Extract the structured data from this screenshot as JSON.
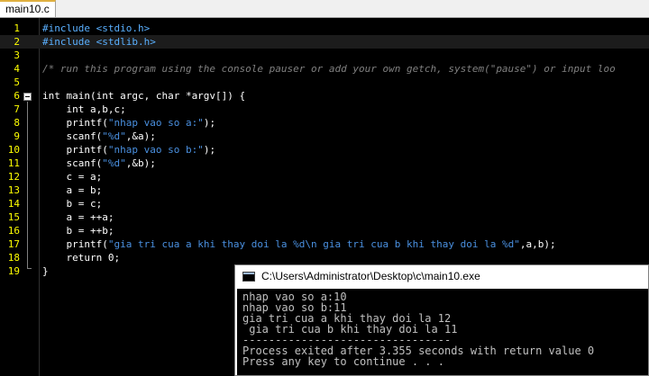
{
  "tab": {
    "label": "main10.c"
  },
  "editor": {
    "lines": [
      {
        "n": "1",
        "parts": [
          {
            "t": "#include <stdio.h>",
            "c": "pp"
          }
        ]
      },
      {
        "n": "2",
        "parts": [
          {
            "t": "#include <stdlib.h>",
            "c": "pp"
          }
        ]
      },
      {
        "n": "3",
        "parts": [
          {
            "t": "",
            "c": ""
          }
        ]
      },
      {
        "n": "4",
        "parts": [
          {
            "t": "/* run this program using the console pauser or add your own getch, system(\"pause\") or input loo",
            "c": "cm"
          }
        ]
      },
      {
        "n": "5",
        "parts": [
          {
            "t": "",
            "c": ""
          }
        ]
      },
      {
        "n": "6",
        "parts": [
          {
            "t": "int main(int argc, char *argv[]) {",
            "c": ""
          }
        ]
      },
      {
        "n": "7",
        "parts": [
          {
            "t": "    int a,b,c;",
            "c": ""
          }
        ]
      },
      {
        "n": "8",
        "parts": [
          {
            "t": "    printf(",
            "c": ""
          },
          {
            "t": "\"nhap vao so a:\"",
            "c": "str"
          },
          {
            "t": ");",
            "c": ""
          }
        ]
      },
      {
        "n": "9",
        "parts": [
          {
            "t": "    scanf(",
            "c": ""
          },
          {
            "t": "\"%d\"",
            "c": "str"
          },
          {
            "t": ",&a);",
            "c": ""
          }
        ]
      },
      {
        "n": "10",
        "parts": [
          {
            "t": "    printf(",
            "c": ""
          },
          {
            "t": "\"nhap vao so b:\"",
            "c": "str"
          },
          {
            "t": ");",
            "c": ""
          }
        ]
      },
      {
        "n": "11",
        "parts": [
          {
            "t": "    scanf(",
            "c": ""
          },
          {
            "t": "\"%d\"",
            "c": "str"
          },
          {
            "t": ",&b);",
            "c": ""
          }
        ]
      },
      {
        "n": "12",
        "parts": [
          {
            "t": "    c = a;",
            "c": ""
          }
        ]
      },
      {
        "n": "13",
        "parts": [
          {
            "t": "    a = b;",
            "c": ""
          }
        ]
      },
      {
        "n": "14",
        "parts": [
          {
            "t": "    b = c;",
            "c": ""
          }
        ]
      },
      {
        "n": "15",
        "parts": [
          {
            "t": "    a = ++a;",
            "c": ""
          }
        ]
      },
      {
        "n": "16",
        "parts": [
          {
            "t": "    b = ++b;",
            "c": ""
          }
        ]
      },
      {
        "n": "17",
        "parts": [
          {
            "t": "    printf(",
            "c": ""
          },
          {
            "t": "\"gia tri cua a khi thay doi la %d\\n gia tri cua b khi thay doi la %d\"",
            "c": "str"
          },
          {
            "t": ",a,b);",
            "c": ""
          }
        ]
      },
      {
        "n": "18",
        "parts": [
          {
            "t": "    return 0;",
            "c": ""
          }
        ]
      },
      {
        "n": "19",
        "parts": [
          {
            "t": "}",
            "c": ""
          }
        ]
      }
    ]
  },
  "console": {
    "title": "C:\\Users\\Administrator\\Desktop\\c\\main10.exe",
    "lines": [
      "nhap vao so a:10",
      "nhap vao so b:11",
      "gia tri cua a khi thay doi la 12",
      " gia tri cua b khi thay doi la 11",
      "--------------------------------",
      "Process exited after 3.355 seconds with return value 0",
      "Press any key to continue . . ."
    ]
  }
}
